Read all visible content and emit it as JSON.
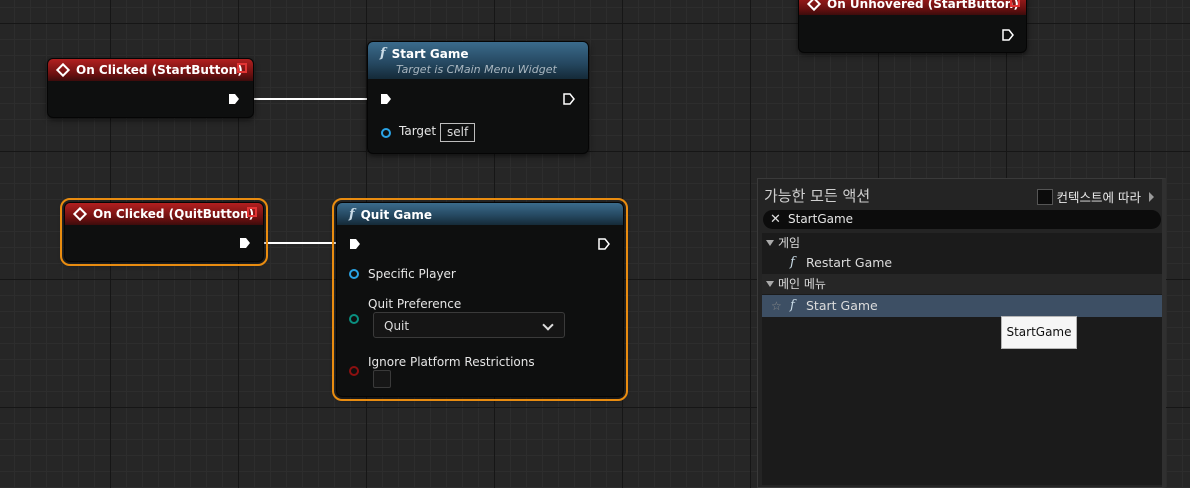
{
  "nodes": {
    "on_clicked_start": {
      "title": "On Clicked (StartButton)"
    },
    "start_game": {
      "title": "Start Game",
      "subtitle": "Target is CMain Menu Widget",
      "target_label": "Target",
      "target_value": "self"
    },
    "on_clicked_quit": {
      "title": "On Clicked (QuitButton)"
    },
    "quit_game": {
      "title": "Quit Game",
      "specific_player_label": "Specific Player",
      "quit_preference_label": "Quit Preference",
      "quit_preference_value": "Quit",
      "ignore_platform_label": "Ignore Platform Restrictions"
    },
    "on_unhovered_start": {
      "title": "On Unhovered (StartButton)"
    }
  },
  "action_menu": {
    "title": "가능한 모든 액션",
    "context_label": "컨텍스트에 따라",
    "search_value": "StartGame",
    "categories": [
      {
        "label": "게임",
        "items": [
          {
            "label": "Restart Game"
          }
        ]
      },
      {
        "label": "메인 메뉴",
        "items": [
          {
            "label": "Start Game",
            "selected": true
          }
        ]
      }
    ]
  },
  "tooltip": {
    "text": "StartGame"
  },
  "colors": {
    "event_header": "#b22020",
    "function_header": "#3b6b8c",
    "selection_outline": "#e98c10",
    "object_pin": "#2aa3e5",
    "byte_pin": "#0a8f80",
    "bool_pin": "#8c1010"
  }
}
